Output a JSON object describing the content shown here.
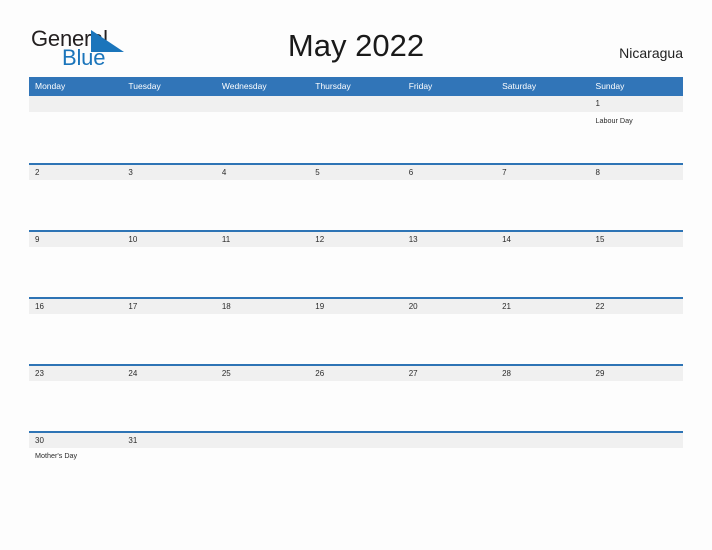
{
  "brand": {
    "name_part1": "General",
    "name_part2": "Blue",
    "triangle_icon": "triangle-logo-icon",
    "color_dark": "#231f20",
    "color_blue": "#1b75bb"
  },
  "header": {
    "title": "May 2022",
    "country": "Nicaragua"
  },
  "theme": {
    "header_blue": "#3175b8",
    "rule_blue": "#2e74b5",
    "date_band_gray": "#f0f0f0",
    "page_background": "#fdfdfd",
    "text_dark": "#2b2b2b",
    "header_text": "#ffffff"
  },
  "calendar": {
    "weekdays": [
      "Monday",
      "Tuesday",
      "Wednesday",
      "Thursday",
      "Friday",
      "Saturday",
      "Sunday"
    ],
    "weeks": [
      {
        "days": [
          {
            "date": "",
            "event": ""
          },
          {
            "date": "",
            "event": ""
          },
          {
            "date": "",
            "event": ""
          },
          {
            "date": "",
            "event": ""
          },
          {
            "date": "",
            "event": ""
          },
          {
            "date": "",
            "event": ""
          },
          {
            "date": "1",
            "event": "Labour Day"
          }
        ]
      },
      {
        "days": [
          {
            "date": "2",
            "event": ""
          },
          {
            "date": "3",
            "event": ""
          },
          {
            "date": "4",
            "event": ""
          },
          {
            "date": "5",
            "event": ""
          },
          {
            "date": "6",
            "event": ""
          },
          {
            "date": "7",
            "event": ""
          },
          {
            "date": "8",
            "event": ""
          }
        ]
      },
      {
        "days": [
          {
            "date": "9",
            "event": ""
          },
          {
            "date": "10",
            "event": ""
          },
          {
            "date": "11",
            "event": ""
          },
          {
            "date": "12",
            "event": ""
          },
          {
            "date": "13",
            "event": ""
          },
          {
            "date": "14",
            "event": ""
          },
          {
            "date": "15",
            "event": ""
          }
        ]
      },
      {
        "days": [
          {
            "date": "16",
            "event": ""
          },
          {
            "date": "17",
            "event": ""
          },
          {
            "date": "18",
            "event": ""
          },
          {
            "date": "19",
            "event": ""
          },
          {
            "date": "20",
            "event": ""
          },
          {
            "date": "21",
            "event": ""
          },
          {
            "date": "22",
            "event": ""
          }
        ]
      },
      {
        "days": [
          {
            "date": "23",
            "event": ""
          },
          {
            "date": "24",
            "event": ""
          },
          {
            "date": "25",
            "event": ""
          },
          {
            "date": "26",
            "event": ""
          },
          {
            "date": "27",
            "event": ""
          },
          {
            "date": "28",
            "event": ""
          },
          {
            "date": "29",
            "event": ""
          }
        ]
      },
      {
        "days": [
          {
            "date": "30",
            "event": "Mother's Day"
          },
          {
            "date": "31",
            "event": ""
          },
          {
            "date": "",
            "event": ""
          },
          {
            "date": "",
            "event": ""
          },
          {
            "date": "",
            "event": ""
          },
          {
            "date": "",
            "event": ""
          },
          {
            "date": "",
            "event": ""
          }
        ]
      }
    ]
  }
}
